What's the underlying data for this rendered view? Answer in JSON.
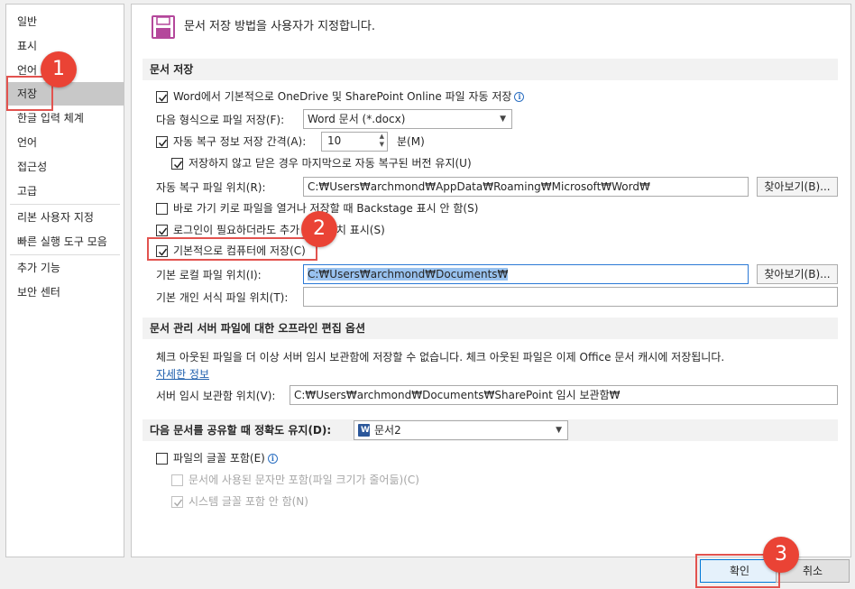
{
  "sidebar": {
    "items": [
      {
        "label": "일반"
      },
      {
        "label": "표시"
      },
      {
        "label": "언어"
      },
      {
        "label": "저장"
      },
      {
        "label": "한글 입력 체계"
      },
      {
        "label": "언어"
      },
      {
        "label": "접근성"
      },
      {
        "label": "고급"
      },
      {
        "label": "리본 사용자 지정"
      },
      {
        "label": "빠른 실행 도구 모음"
      },
      {
        "label": "추가 기능"
      },
      {
        "label": "보안 센터"
      }
    ],
    "selected": "저장"
  },
  "header": {
    "title": "문서 저장 방법을 사용자가 지정합니다.",
    "icon": "floppy-disk-icon",
    "icon_color": "#b4479b"
  },
  "save_section": {
    "title": "문서 저장",
    "onedrive_autosave": {
      "label": "Word에서 기본적으로 OneDrive 및 SharePoint Online 파일 자동 저장",
      "checked": true
    },
    "format_label": "다음 형식으로 파일 저장(F):",
    "format_value": "Word 문서 (*.docx)",
    "autorecover": {
      "label": "자동 복구 정보 저장 간격(A):",
      "checked": true
    },
    "autorecover_minutes": "10",
    "minutes_label": "분(M)",
    "keep_last": {
      "label": "저장하지 않고 닫은 경우 마지막으로 자동 복구된 버전 유지(U)",
      "checked": true
    },
    "autorecover_location_label": "자동 복구 파일 위치(R):",
    "autorecover_location": "C:₩Users₩archmond₩AppData₩Roaming₩Microsoft₩Word₩",
    "browse_label": "찾아보기(B)...",
    "no_backstage": {
      "label": "바로 가기 키로 파일을 열거나 저장할 때 Backstage 표시 안 함(S)",
      "checked": false
    },
    "show_extra": {
      "label": "로그인이 필요하더라도 추가 저장 위치 표시(S)",
      "checked": true
    },
    "save_to_computer": {
      "label": "기본적으로 컴퓨터에 저장(C)",
      "checked": true
    },
    "local_location_label": "기본 로컬 파일 위치(I):",
    "local_location": "C:₩Users₩archmond₩Documents₩",
    "template_location_label": "기본 개인 서식 파일 위치(T):",
    "template_location": ""
  },
  "offline_section": {
    "title": "문서 관리 서버 파일에 대한 오프라인 편집 옵션",
    "info": "체크 아웃된 파일을 더 이상 서버 임시 보관함에 저장할 수 없습니다. 체크 아웃된 파일은 이제 Office 문서 캐시에 저장됩니다.",
    "more_info": "자세한 정보",
    "drafts_label": "서버 임시 보관함 위치(V):",
    "drafts_location": "C:₩Users₩archmond₩Documents₩SharePoint 임시 보관함₩"
  },
  "fidelity_section": {
    "title": "다음 문서를 공유할 때 정확도 유지(D):",
    "document": "문서2",
    "embed_fonts": {
      "label": "파일의 글꼴 포함(E)",
      "checked": false
    },
    "embed_used_only": {
      "label": "문서에 사용된 문자만 포함(파일 크기가 줄어듦)(C)",
      "checked": false
    },
    "no_system_fonts": {
      "label": "시스템 글꼴 포함 안 함(N)",
      "checked": true
    }
  },
  "footer": {
    "ok": "확인",
    "cancel": "취소"
  },
  "steps": [
    "1",
    "2",
    "3"
  ],
  "colors": {
    "highlight": "#e2534f",
    "step_badge": "#ea4335",
    "selection": "#99c2ef",
    "link": "#1f5fad"
  }
}
